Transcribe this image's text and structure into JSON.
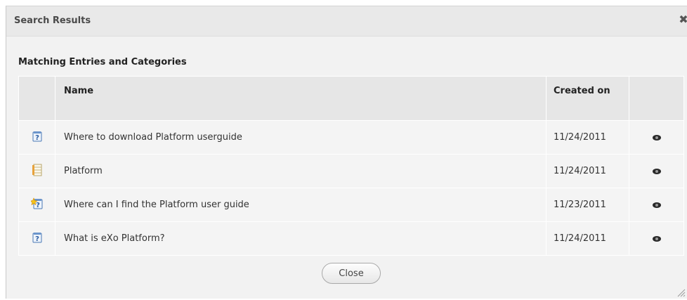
{
  "dialog": {
    "title": "Search Results",
    "close_icon": "close-x-icon",
    "section_title": "Matching Entries and Categories",
    "close_button_label": "Close",
    "resize_icon": "resize-grip-icon"
  },
  "table": {
    "columns": [
      "",
      "Name",
      "Created on",
      ""
    ],
    "rows": [
      {
        "icon": "question-entry-icon",
        "name": "Where to download Platform userguide",
        "created": "11/24/2011",
        "action_icon": "view-eye-icon"
      },
      {
        "icon": "category-icon",
        "name": "Platform",
        "created": "11/24/2011",
        "action_icon": "view-eye-icon"
      },
      {
        "icon": "question-new-entry-icon",
        "name": "Where can I find the Platform user guide",
        "created": "11/23/2011",
        "action_icon": "view-eye-icon"
      },
      {
        "icon": "question-entry-icon",
        "name": "What is eXo Platform?",
        "created": "11/24/2011",
        "action_icon": "view-eye-icon"
      }
    ]
  }
}
